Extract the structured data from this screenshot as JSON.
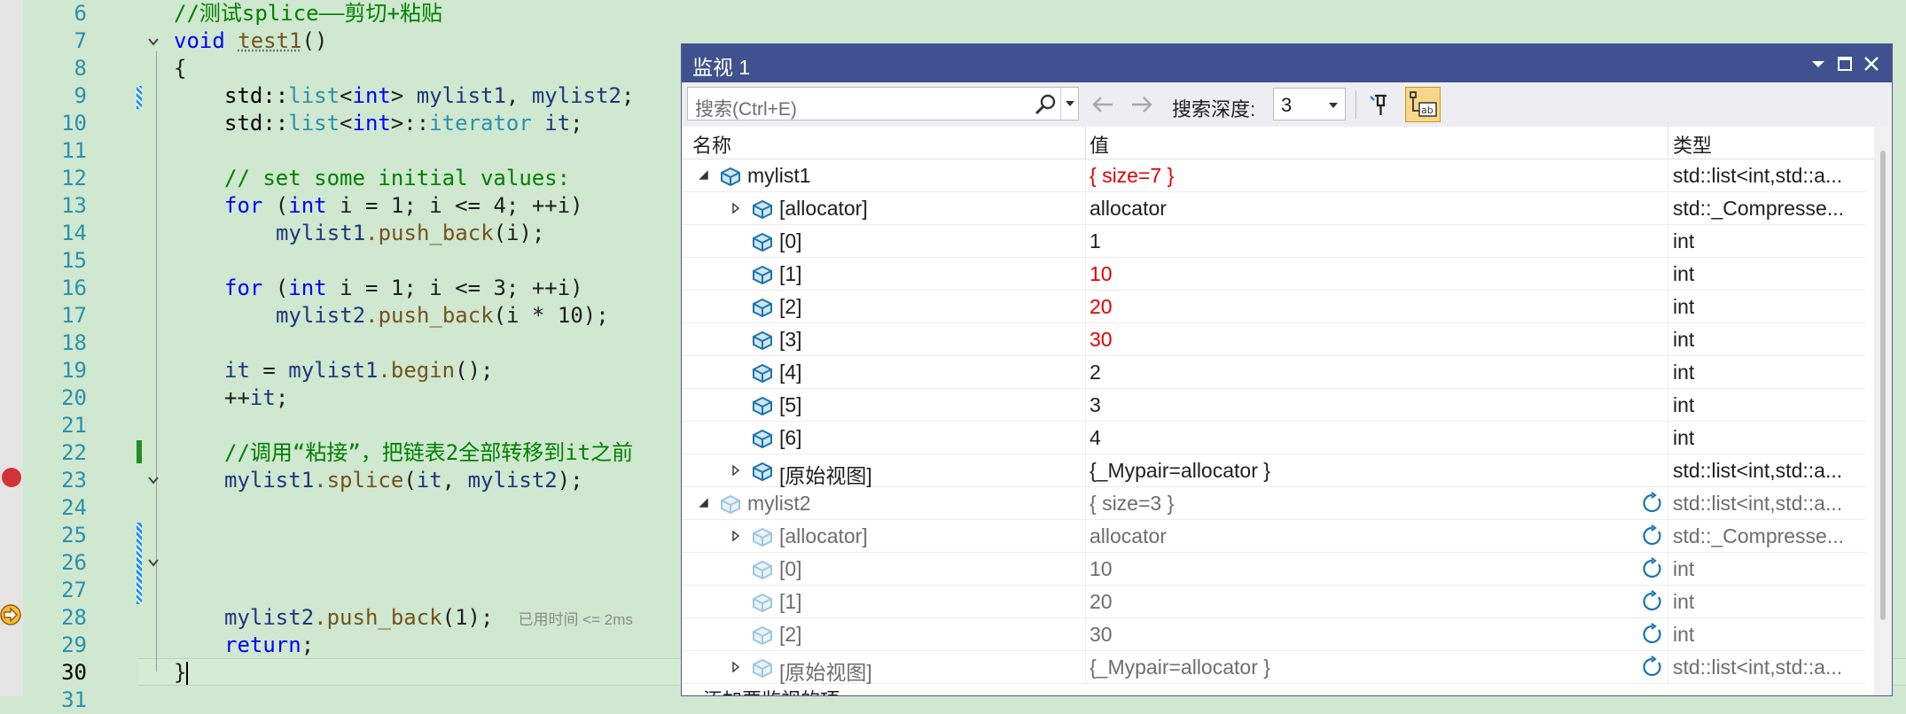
{
  "editor": {
    "lines": [
      {
        "n": "6"
      },
      {
        "n": "7"
      },
      {
        "n": "8"
      },
      {
        "n": "9"
      },
      {
        "n": "10"
      },
      {
        "n": "11"
      },
      {
        "n": "12"
      },
      {
        "n": "13"
      },
      {
        "n": "14"
      },
      {
        "n": "15"
      },
      {
        "n": "16"
      },
      {
        "n": "17"
      },
      {
        "n": "18"
      },
      {
        "n": "19"
      },
      {
        "n": "20"
      },
      {
        "n": "21"
      },
      {
        "n": "22"
      },
      {
        "n": "23"
      },
      {
        "n": "24"
      },
      {
        "n": "25"
      },
      {
        "n": "26"
      },
      {
        "n": "27"
      },
      {
        "n": "28"
      },
      {
        "n": "29"
      },
      {
        "n": "30"
      },
      {
        "n": "31"
      }
    ],
    "code": {
      "l6": "//测试splice——剪切+粘贴",
      "l7_kw": "void",
      "l7_fn": "test1",
      "l7_rest": "()",
      "l8": "{",
      "l9_a": "std::",
      "l9_b": "list",
      "l9_c": "<",
      "l9_d": "int",
      "l9_e": "> ",
      "l9_f": "mylist1",
      "l9_g": ", ",
      "l9_h": "mylist2",
      "l9_i": ";",
      "l10_a": "std::",
      "l10_b": "list",
      "l10_c": "<",
      "l10_d": "int",
      "l10_e": ">::",
      "l10_f": "iterator",
      "l10_g": " ",
      "l10_h": "it",
      "l10_i": ";",
      "l12": "// set some initial values:",
      "l13_kw": "for",
      "l13_a": " (",
      "l13_int": "int",
      "l13_b": " i = 1; i <= 4; ++i)",
      "l14_v": "mylist1",
      "l14_f": ".push_back",
      "l14_r": "(i);",
      "l16_kw": "for",
      "l16_a": " (",
      "l16_int": "int",
      "l16_b": " i = 1; i <= 3; ++i)",
      "l17_v": "mylist2",
      "l17_f": ".push_back",
      "l17_r": "(i * 10);",
      "l19_v": "it",
      "l19_a": " = ",
      "l19_v2": "mylist1",
      "l19_f": ".begin",
      "l19_r": "();",
      "l20_a": "++",
      "l20_v": "it",
      "l20_r": ";",
      "l22": "//调用“粘接”，把链表2全部转移到it之前",
      "l23_v": "mylist1",
      "l23_f": ".splice",
      "l23_a": "(",
      "l23_v2": "it",
      "l23_b": ", ",
      "l23_v3": "mylist2",
      "l23_r": ");",
      "l28_v": "mylist2",
      "l28_f": ".push_back",
      "l28_r": "(1);",
      "l28_hint": "已用时间 <= 2ms",
      "l29_kw": "return",
      "l29_r": ";",
      "l30": "}"
    }
  },
  "watch": {
    "title": "监视 1",
    "search_placeholder": "搜索(Ctrl+E)",
    "depth_label": "搜索深度:",
    "depth_value": "3",
    "columns": {
      "name": "名称",
      "value": "值",
      "type": "类型"
    },
    "rows": [
      {
        "name": "mylist1",
        "value": "{ size=7 }",
        "type": "std::list<int,std::a...",
        "indent": 0,
        "expand": "open",
        "icon": "var",
        "vcolor": "red",
        "stale": false
      },
      {
        "name": "[allocator]",
        "value": "allocator",
        "type": "std::_Compresse...",
        "indent": 1,
        "expand": "closed",
        "icon": "var",
        "vcolor": "blk",
        "stale": false
      },
      {
        "name": "[0]",
        "value": "1",
        "type": "int",
        "indent": 1,
        "expand": "none",
        "icon": "var",
        "vcolor": "blk",
        "stale": false
      },
      {
        "name": "[1]",
        "value": "10",
        "type": "int",
        "indent": 1,
        "expand": "none",
        "icon": "var",
        "vcolor": "red",
        "stale": false
      },
      {
        "name": "[2]",
        "value": "20",
        "type": "int",
        "indent": 1,
        "expand": "none",
        "icon": "var",
        "vcolor": "red",
        "stale": false
      },
      {
        "name": "[3]",
        "value": "30",
        "type": "int",
        "indent": 1,
        "expand": "none",
        "icon": "var",
        "vcolor": "red",
        "stale": false
      },
      {
        "name": "[4]",
        "value": "2",
        "type": "int",
        "indent": 1,
        "expand": "none",
        "icon": "var",
        "vcolor": "blk",
        "stale": false
      },
      {
        "name": "[5]",
        "value": "3",
        "type": "int",
        "indent": 1,
        "expand": "none",
        "icon": "var",
        "vcolor": "blk",
        "stale": false
      },
      {
        "name": "[6]",
        "value": "4",
        "type": "int",
        "indent": 1,
        "expand": "none",
        "icon": "var",
        "vcolor": "blk",
        "stale": false
      },
      {
        "name": "[原始视图]",
        "value": "{_Mypair=allocator }",
        "type": "std::list<int,std::a...",
        "indent": 1,
        "expand": "closed",
        "icon": "var",
        "vcolor": "blk",
        "stale": false
      },
      {
        "name": "mylist2",
        "value": "{ size=3 }",
        "type": "std::list<int,std::a...",
        "indent": 0,
        "expand": "open",
        "icon": "var",
        "vcolor": "grey",
        "stale": true
      },
      {
        "name": "[allocator]",
        "value": "allocator",
        "type": "std::_Compresse...",
        "indent": 1,
        "expand": "closed",
        "icon": "var",
        "vcolor": "grey",
        "stale": true
      },
      {
        "name": "[0]",
        "value": "10",
        "type": "int",
        "indent": 1,
        "expand": "none",
        "icon": "var",
        "vcolor": "grey",
        "stale": true
      },
      {
        "name": "[1]",
        "value": "20",
        "type": "int",
        "indent": 1,
        "expand": "none",
        "icon": "var",
        "vcolor": "grey",
        "stale": true
      },
      {
        "name": "[2]",
        "value": "30",
        "type": "int",
        "indent": 1,
        "expand": "none",
        "icon": "var",
        "vcolor": "grey",
        "stale": true
      },
      {
        "name": "[原始视图]",
        "value": "{_Mypair=allocator }",
        "type": "std::list<int,std::a...",
        "indent": 1,
        "expand": "closed",
        "icon": "var",
        "vcolor": "grey",
        "stale": true
      }
    ],
    "add_item": "添加要监视的项"
  },
  "colors": {
    "editor_bg": "#cfe8cf",
    "title_bar": "#40518f",
    "changed_value": "#e00000",
    "breakpoint": "#d13438"
  }
}
